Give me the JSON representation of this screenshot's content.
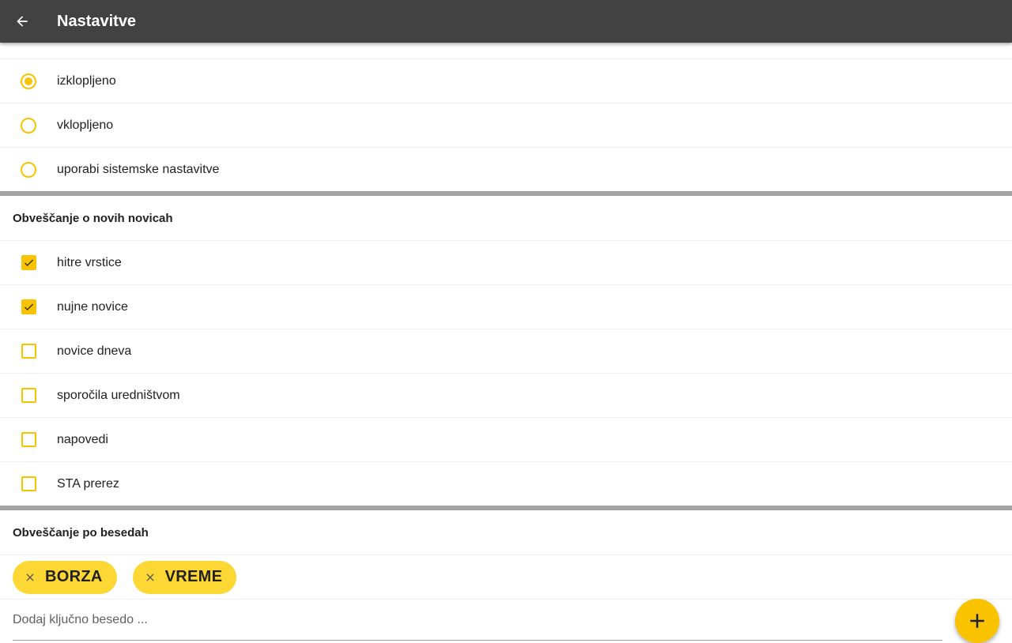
{
  "appbar": {
    "title": "Nastavitve",
    "back_icon": "arrow-left-icon"
  },
  "theme_options": [
    {
      "label": "izklopljeno",
      "selected": true
    },
    {
      "label": "vklopljeno",
      "selected": false
    },
    {
      "label": "uporabi sistemske nastavitve",
      "selected": false
    }
  ],
  "news_section": {
    "title": "Obveščanje o novih novicah",
    "items": [
      {
        "label": "hitre vrstice",
        "checked": true
      },
      {
        "label": "nujne novice",
        "checked": true
      },
      {
        "label": "novice dneva",
        "checked": false
      },
      {
        "label": "sporočila uredništvom",
        "checked": false
      },
      {
        "label": "napovedi",
        "checked": false
      },
      {
        "label": "STA prerez",
        "checked": false
      }
    ]
  },
  "keywords_section": {
    "title": "Obveščanje po besedah",
    "chips": [
      {
        "label": "BORZA"
      },
      {
        "label": "VREME"
      }
    ],
    "input": {
      "value": "",
      "placeholder": "Dodaj ključno besedo ..."
    },
    "add_icon": "plus-icon"
  },
  "colors": {
    "appbar": "#424242",
    "accent": "#f9c300",
    "chip": "#fdd835",
    "divider": "#a3a3a3"
  }
}
